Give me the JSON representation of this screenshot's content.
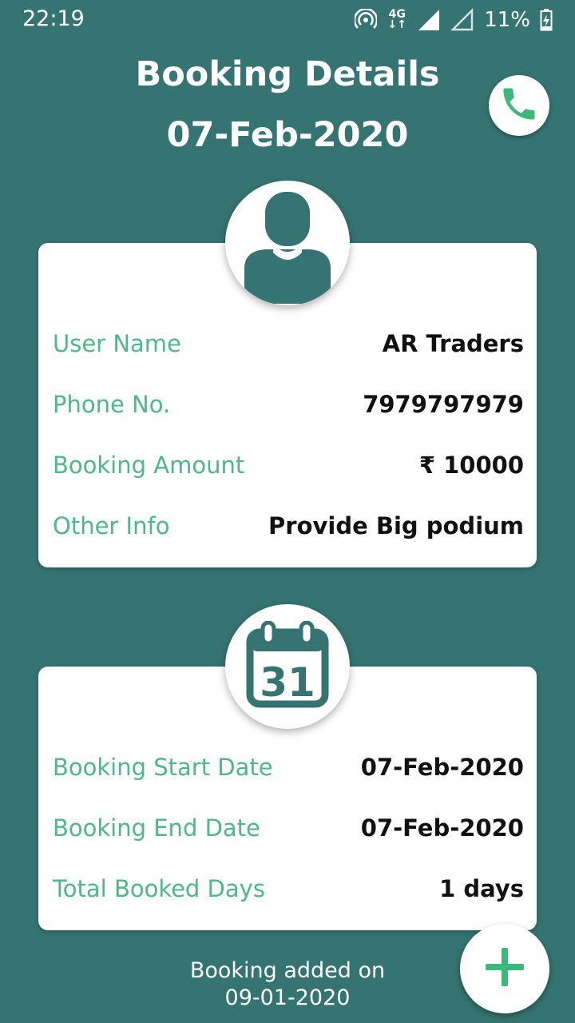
{
  "status_bar": {
    "time": "22:19",
    "network_type": "4G",
    "battery_percent": "11%",
    "icons": [
      "hotspot-icon",
      "network-4g-icon",
      "signal-full-icon",
      "signal-empty-icon",
      "battery-charging-icon"
    ]
  },
  "header": {
    "title": "Booking Details",
    "date": "07-Feb-2020",
    "call_icon": "phone-icon"
  },
  "user_card": {
    "icon": "user-avatar-icon",
    "rows": [
      {
        "label": "User Name",
        "value": "AR Traders"
      },
      {
        "label": "Phone No.",
        "value": "7979797979"
      },
      {
        "label": "Booking Amount",
        "value": "₹ 10000"
      },
      {
        "label": "Other Info",
        "value": "Provide Big podium"
      }
    ]
  },
  "dates_card": {
    "icon": "calendar-icon",
    "calendar_day": "31",
    "rows": [
      {
        "label": "Booking Start Date",
        "value": "07-Feb-2020"
      },
      {
        "label": "Booking End Date",
        "value": "07-Feb-2020"
      },
      {
        "label": "Total Booked Days",
        "value": "1 days"
      }
    ]
  },
  "footer": {
    "added_label": "Booking added on",
    "added_date": "09-01-2020",
    "add_icon": "plus-icon"
  },
  "colors": {
    "background": "#357472",
    "label_green": "#4db888",
    "call_green": "#3cb878",
    "avatar_teal": "#357472"
  }
}
